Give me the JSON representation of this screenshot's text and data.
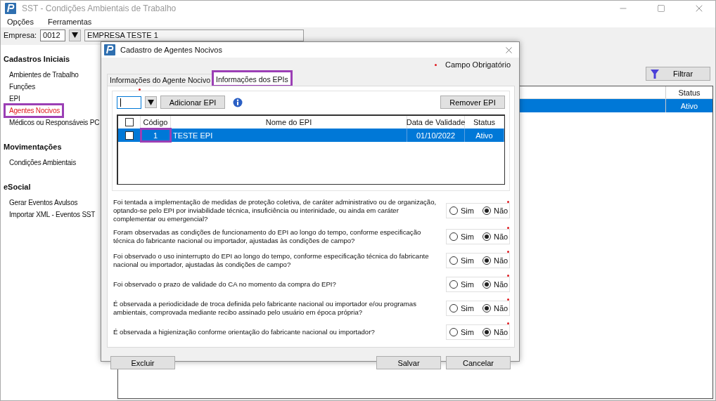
{
  "window": {
    "title": "SST - Condições Ambientais de Trabalho"
  },
  "menu": [
    {
      "label": "Opções"
    },
    {
      "label": "Ferramentas"
    }
  ],
  "company": {
    "label": "Empresa:",
    "code": "0012",
    "name": "EMPRESA TESTE 1"
  },
  "sidebar": {
    "sections": [
      {
        "title": "Cadastros Iniciais",
        "items": [
          {
            "label": "Ambientes de Trabalho",
            "selected": false,
            "highlighted": false
          },
          {
            "label": "Funções",
            "selected": false,
            "highlighted": false
          },
          {
            "label": "EPI",
            "selected": false,
            "highlighted": false
          },
          {
            "label": "Agentes Nocivos",
            "selected": true,
            "highlighted": true
          },
          {
            "label": "Médicos ou Responsáveis PC",
            "selected": false,
            "highlighted": false
          }
        ]
      },
      {
        "title": "Movimentações",
        "items": [
          {
            "label": "Condições Ambientais",
            "selected": false,
            "highlighted": false
          }
        ]
      },
      {
        "title": "eSocial",
        "items": [
          {
            "label": "Gerar Eventos Avulsos",
            "selected": false,
            "highlighted": false
          },
          {
            "label": "Importar XML - Eventos SST",
            "selected": false,
            "highlighted": false
          }
        ]
      }
    ]
  },
  "main_table": {
    "filter_button": "Filtrar",
    "columns": [
      "Status"
    ],
    "rows": [
      {
        "status": "Ativo",
        "selected": true
      }
    ]
  },
  "dialog": {
    "title": "Cadastro de Agentes Nocivos",
    "required_note": "Campo Obrigatório",
    "tabs": [
      {
        "label": "Informações do Agente Nocivo",
        "selected": false,
        "highlighted": false
      },
      {
        "label": "Informações dos EPIs",
        "selected": true,
        "highlighted": true
      }
    ],
    "add_button": "Adicionar EPI",
    "remove_button": "Remover EPI",
    "grid": {
      "header_checked": false,
      "columns": [
        "Código",
        "Nome do EPI",
        "Data de Validade",
        "Status"
      ],
      "rows": [
        {
          "checked": false,
          "selected": true,
          "code": "1",
          "code_highlighted": true,
          "name": "TESTE EPI",
          "expiry": "01/10/2022",
          "status": "Ativo"
        }
      ]
    },
    "questions": [
      {
        "text": "Foi tentada a implementação de medidas de proteção coletiva, de caráter administrativo ou de organização, optando-se pelo EPI por inviabilidade técnica, insuficiência ou interinidade, ou ainda em caráter complementar ou emergencial?",
        "required": true,
        "options": [
          {
            "label": "Sim",
            "selected": false
          },
          {
            "label": "Não",
            "selected": true
          }
        ]
      },
      {
        "text": "Foram observadas as condições de funcionamento do EPI ao longo do tempo, conforme especificação técnica do fabricante nacional ou importador, ajustadas às condições de campo?",
        "required": true,
        "options": [
          {
            "label": "Sim",
            "selected": false
          },
          {
            "label": "Não",
            "selected": true
          }
        ]
      },
      {
        "text": "Foi observado o uso ininterrupto do EPI ao longo do tempo, conforme especificação técnica do fabricante nacional ou importador, ajustadas às condições de campo?",
        "required": true,
        "options": [
          {
            "label": "Sim",
            "selected": false
          },
          {
            "label": "Não",
            "selected": true
          }
        ]
      },
      {
        "text": "Foi observado o prazo de validade do CA no momento da compra do EPI?",
        "required": true,
        "options": [
          {
            "label": "Sim",
            "selected": false
          },
          {
            "label": "Não",
            "selected": true
          }
        ]
      },
      {
        "text": "É observada a periodicidade de troca definida pelo fabricante nacional ou importador e/ou programas ambientais, comprovada mediante recibo assinado pelo usuário em época própria?",
        "required": true,
        "options": [
          {
            "label": "Sim",
            "selected": false
          },
          {
            "label": "Não",
            "selected": true
          }
        ]
      },
      {
        "text": "É observada a higienização conforme orientação do fabricante nacional ou importador?",
        "required": true,
        "options": [
          {
            "label": "Sim",
            "selected": false
          },
          {
            "label": "Não",
            "selected": true
          }
        ]
      }
    ],
    "buttons": [
      {
        "label": "Excluir",
        "kind": "left"
      },
      {
        "label": "Salvar",
        "kind": "right"
      },
      {
        "label": "Cancelar",
        "kind": "right"
      }
    ]
  }
}
